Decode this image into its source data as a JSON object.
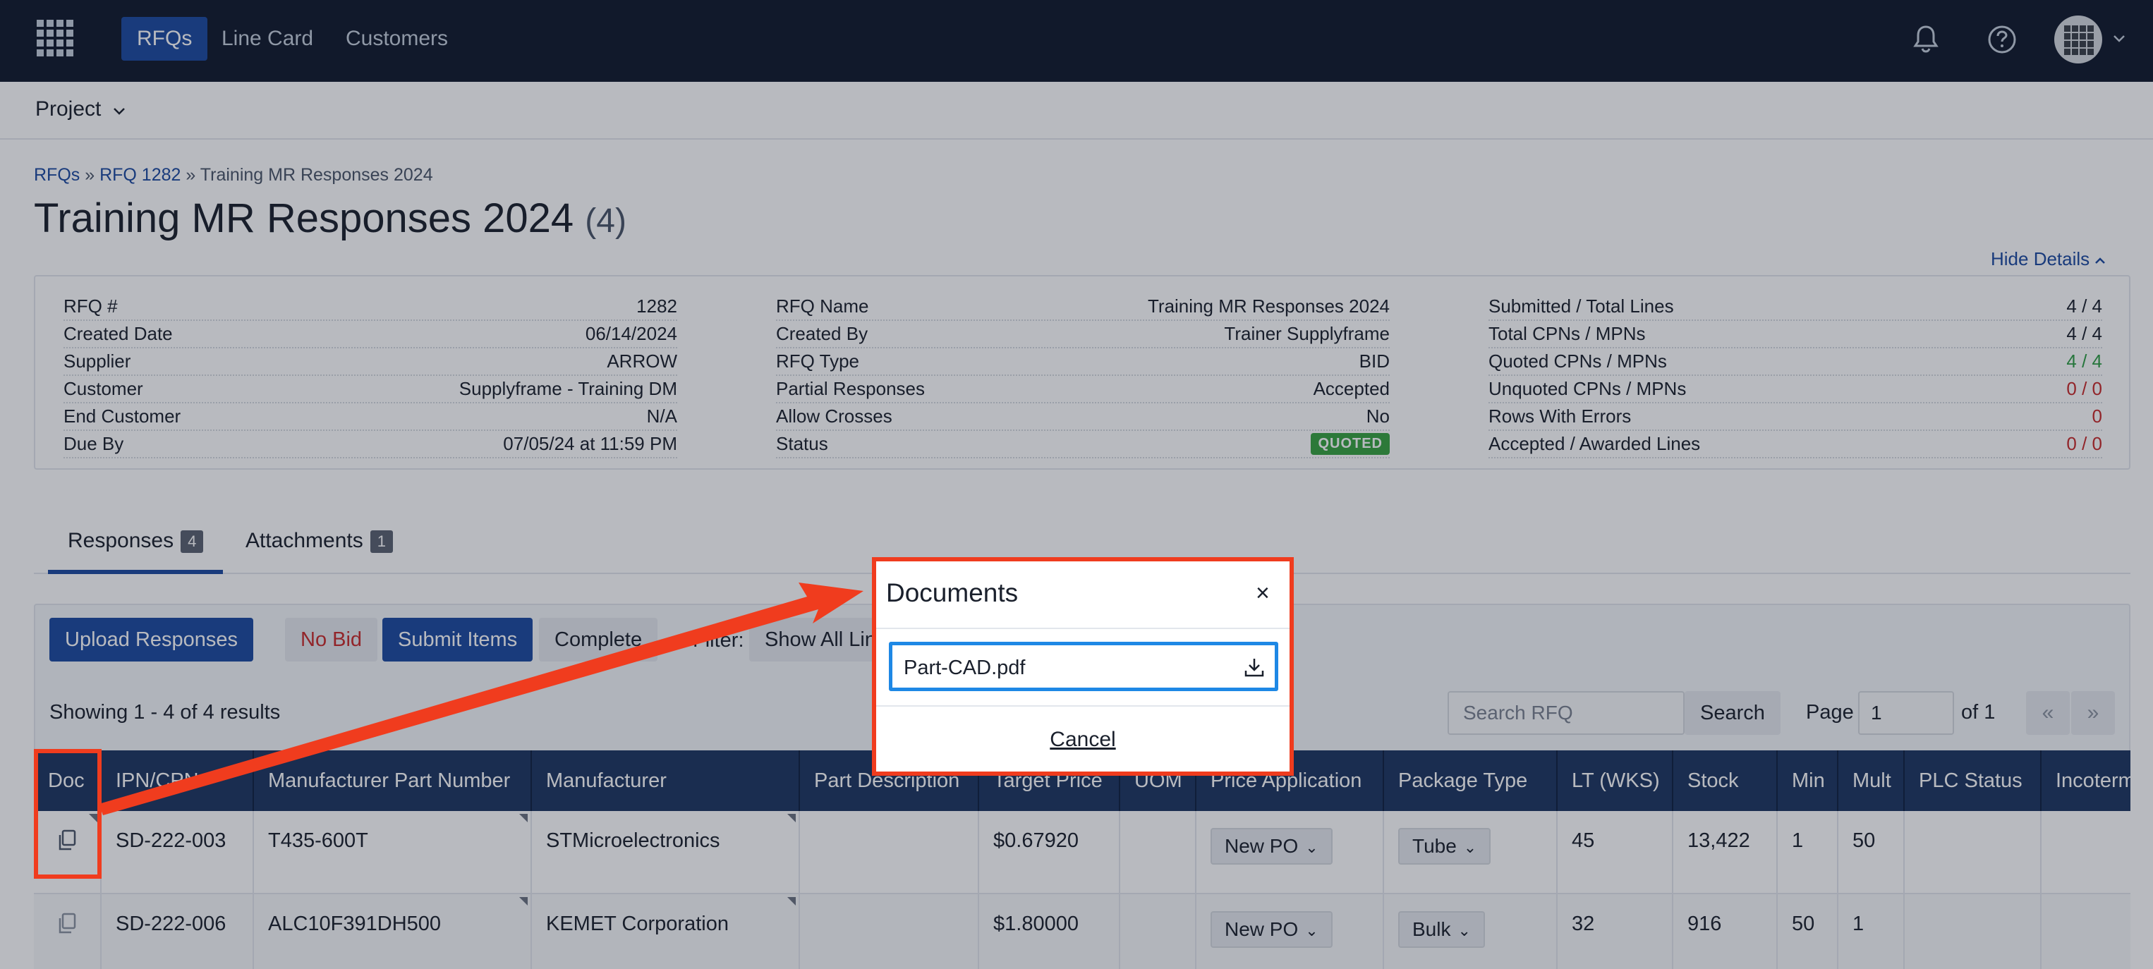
{
  "nav": {
    "items": [
      {
        "label": "RFQs",
        "active": true
      },
      {
        "label": "Line Card",
        "active": false
      },
      {
        "label": "Customers",
        "active": false
      }
    ]
  },
  "project": {
    "label": "Project"
  },
  "breadcrumb": {
    "root": "RFQs",
    "rfq": "RFQ 1282",
    "current": "Training MR Responses 2024"
  },
  "page": {
    "title": "Training MR Responses 2024",
    "count": "(4)",
    "hide_details": "Hide Details"
  },
  "details": {
    "col1": [
      {
        "label": "RFQ #",
        "value": "1282"
      },
      {
        "label": "Created Date",
        "value": "06/14/2024"
      },
      {
        "label": "Supplier",
        "value": "ARROW"
      },
      {
        "label": "Customer",
        "value": "Supplyframe - Training DM"
      },
      {
        "label": "End Customer",
        "value": "N/A"
      },
      {
        "label": "Due By",
        "value": "07/05/24 at 11:59 PM"
      }
    ],
    "col2": [
      {
        "label": "RFQ Name",
        "value": "Training MR Responses 2024"
      },
      {
        "label": "Created By",
        "value": "Trainer Supplyframe"
      },
      {
        "label": "RFQ Type",
        "value": "BID"
      },
      {
        "label": "Partial Responses",
        "value": "Accepted"
      },
      {
        "label": "Allow Crosses",
        "value": "No"
      },
      {
        "label": "Status",
        "value": "QUOTED"
      }
    ],
    "col3": [
      {
        "label": "Submitted / Total Lines",
        "value": "4 / 4"
      },
      {
        "label": "Total CPNs / MPNs",
        "value": "4 / 4"
      },
      {
        "label": "Quoted CPNs / MPNs",
        "value": "4 / 4"
      },
      {
        "label": "Unquoted CPNs / MPNs",
        "value": "0 / 0"
      },
      {
        "label": "Rows With Errors",
        "value": "0"
      },
      {
        "label": "Accepted / Awarded Lines",
        "value": "0 / 0"
      }
    ],
    "colors": {
      "green": "#2f9e44",
      "red": "#c92a2a",
      "quoted_badge": "#37a240"
    }
  },
  "tabs": [
    {
      "label": "Responses",
      "count": "4"
    },
    {
      "label": "Attachments",
      "count": "1"
    }
  ],
  "toolbar": {
    "upload": "Upload Responses",
    "no_bid": "No Bid",
    "submit": "Submit Items",
    "complete": "Complete",
    "filter_label": "Filter:",
    "filter_value": "Show All Lines"
  },
  "results": {
    "showing": "Showing 1 - 4 of 4 results",
    "search_placeholder": "Search RFQ",
    "search_button": "Search",
    "page_label": "Page",
    "page_value": "1",
    "of_label": "of 1",
    "prev": "«",
    "next": "»"
  },
  "table": {
    "columns": [
      "Doc",
      "IPN/CPN",
      "Manufacturer Part Number",
      "Manufacturer",
      "Part Description",
      "Target Price",
      "UOM",
      "Price Application",
      "Package Type",
      "LT (WKS)",
      "Stock",
      "Min",
      "Mult",
      "PLC Status",
      "Incoterms"
    ],
    "rows": [
      {
        "ipn": "SD-222-003",
        "mpn": "T435-600T",
        "manufacturer": "STMicroelectronics",
        "description": "",
        "target_price": "$0.67920",
        "uom": "",
        "price_application": "New PO",
        "package_type": "Tube",
        "lt": "45",
        "stock": "13,422",
        "min": "1",
        "mult": "50",
        "plc": "",
        "incoterms": ""
      },
      {
        "ipn": "SD-222-006",
        "mpn": "ALC10F391DH500",
        "manufacturer": "KEMET Corporation",
        "description": "",
        "target_price": "$1.80000",
        "uom": "",
        "price_application": "New PO",
        "package_type": "Bulk",
        "lt": "32",
        "stock": "916",
        "min": "50",
        "mult": "1",
        "plc": "",
        "incoterms": ""
      }
    ]
  },
  "modal": {
    "title": "Documents",
    "close": "×",
    "file": "Part-CAD.pdf",
    "cancel": "Cancel"
  },
  "annotation": {
    "color": "#f03c1e"
  }
}
